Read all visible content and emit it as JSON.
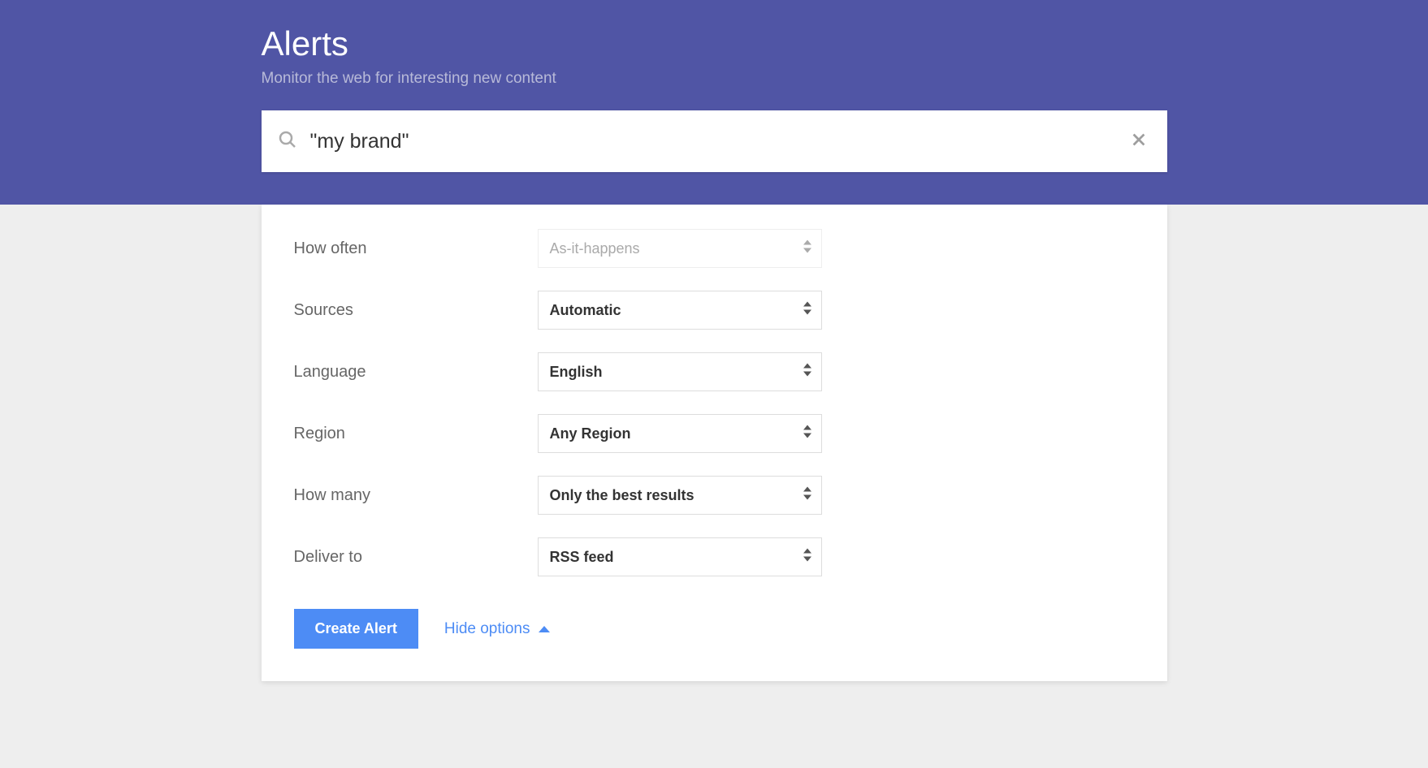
{
  "header": {
    "title": "Alerts",
    "subtitle": "Monitor the web for interesting new content"
  },
  "search": {
    "value": "\"my brand\""
  },
  "options": {
    "how_often": {
      "label": "How often",
      "value": "As-it-happens"
    },
    "sources": {
      "label": "Sources",
      "value": "Automatic"
    },
    "language": {
      "label": "Language",
      "value": "English"
    },
    "region": {
      "label": "Region",
      "value": "Any Region"
    },
    "how_many": {
      "label": "How many",
      "value": "Only the best results"
    },
    "deliver_to": {
      "label": "Deliver to",
      "value": "RSS feed"
    }
  },
  "actions": {
    "create_label": "Create Alert",
    "hide_options_label": "Hide options"
  }
}
